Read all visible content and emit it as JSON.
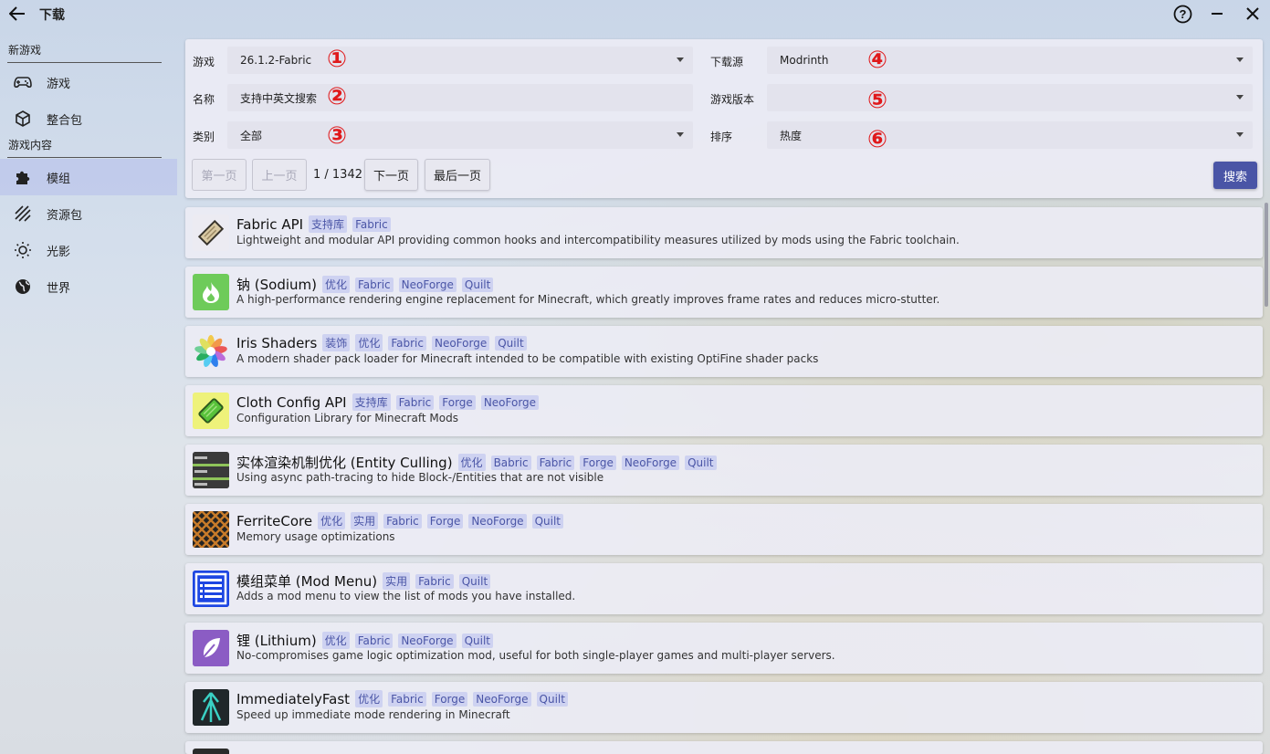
{
  "window": {
    "title": "下载"
  },
  "sidebar": {
    "sections": [
      {
        "header": "新游戏",
        "items": [
          {
            "label": "游戏",
            "icon": "gamepad-icon"
          },
          {
            "label": "整合包",
            "icon": "package-icon"
          }
        ]
      },
      {
        "header": "游戏内容",
        "items": [
          {
            "label": "模组",
            "icon": "puzzle-icon",
            "active": true
          },
          {
            "label": "资源包",
            "icon": "stripes-icon"
          },
          {
            "label": "光影",
            "icon": "sun-icon"
          },
          {
            "label": "世界",
            "icon": "globe-icon"
          }
        ]
      }
    ]
  },
  "filters": {
    "game_label": "游戏",
    "game_value": "26.1.2-Fabric",
    "name_label": "名称",
    "name_placeholder": "支持中英文搜索",
    "category_label": "类别",
    "category_value": "全部",
    "source_label": "下载源",
    "source_value": "Modrinth",
    "version_label": "游戏版本",
    "version_value": "",
    "sort_label": "排序",
    "sort_value": "热度",
    "annotations": [
      "①",
      "②",
      "③",
      "④",
      "⑤",
      "⑥"
    ]
  },
  "pagination": {
    "first": "第一页",
    "prev": "上一页",
    "page_text": "1 / 1342",
    "next": "下一页",
    "last": "最后一页",
    "search": "搜索"
  },
  "mods": [
    {
      "name": "Fabric API",
      "tags": [
        "支持库",
        "Fabric"
      ],
      "desc": "Lightweight and modular API providing common hooks and intercompatibility measures utilized by mods using the Fabric toolchain.",
      "icon": "scroll-icon"
    },
    {
      "name": "钠 (Sodium)",
      "tags": [
        "优化",
        "Fabric",
        "NeoForge",
        "Quilt"
      ],
      "desc": "A high-performance rendering engine replacement for Minecraft, which greatly improves frame rates and reduces micro-stutter.",
      "icon": "flame-icon"
    },
    {
      "name": "Iris Shaders",
      "tags": [
        "装饰",
        "优化",
        "Fabric",
        "NeoForge",
        "Quilt"
      ],
      "desc": "A modern shader pack loader for Minecraft intended to be compatible with existing OptiFine shader packs",
      "icon": "flower-icon"
    },
    {
      "name": "Cloth Config API",
      "tags": [
        "支持库",
        "Fabric",
        "Forge",
        "NeoForge"
      ],
      "desc": "Configuration Library for Minecraft Mods",
      "icon": "ticket-icon"
    },
    {
      "name": "实体渲染机制优化 (Entity Culling)",
      "tags": [
        "优化",
        "Babric",
        "Fabric",
        "Forge",
        "NeoForge",
        "Quilt"
      ],
      "desc": "Using async path-tracing to hide Block-/Entities that are not visible",
      "icon": "fps-icon"
    },
    {
      "name": "FerriteCore",
      "tags": [
        "优化",
        "实用",
        "Fabric",
        "Forge",
        "NeoForge",
        "Quilt"
      ],
      "desc": "Memory usage optimizations",
      "icon": "lattice-icon"
    },
    {
      "name": "模组菜单 (Mod Menu)",
      "tags": [
        "实用",
        "Fabric",
        "Quilt"
      ],
      "desc": "Adds a mod menu to view the list of mods you have installed.",
      "icon": "list-icon"
    },
    {
      "name": "锂 (Lithium)",
      "tags": [
        "优化",
        "Fabric",
        "NeoForge",
        "Quilt"
      ],
      "desc": "No-compromises game logic optimization mod, useful for both single-player games and multi-player servers.",
      "icon": "feather-icon"
    },
    {
      "name": "ImmediatelyFast",
      "tags": [
        "优化",
        "Fabric",
        "Forge",
        "NeoForge",
        "Quilt"
      ],
      "desc": "Speed up immediate mode rendering in Minecraft",
      "icon": "arrows-up-icon"
    }
  ],
  "colors": {
    "accent": "#4a55a6",
    "annotation": "#e0191b",
    "tag_text": "#4a55a6"
  }
}
